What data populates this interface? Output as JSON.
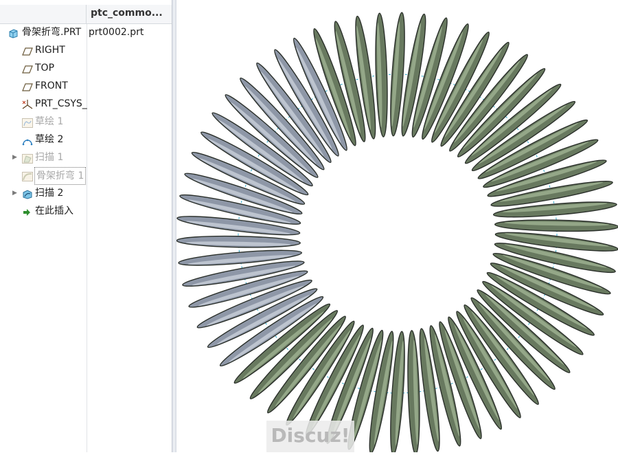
{
  "tree_header": {
    "column_title": "ptc_commo..."
  },
  "model_tree": [
    {
      "label": "骨架折弯.PRT",
      "icon": "part-icon",
      "col2": "prt0002.prt",
      "expandable": false,
      "state": "normal"
    },
    {
      "label": "RIGHT",
      "icon": "datum-plane-icon",
      "expandable": false,
      "state": "normal"
    },
    {
      "label": "TOP",
      "icon": "datum-plane-icon",
      "expandable": false,
      "state": "normal"
    },
    {
      "label": "FRONT",
      "icon": "datum-plane-icon",
      "expandable": false,
      "state": "normal"
    },
    {
      "label": "PRT_CSYS_",
      "icon": "csys-icon",
      "expandable": false,
      "state": "normal"
    },
    {
      "label": "草绘 1",
      "icon": "sketch-icon",
      "expandable": false,
      "state": "suppressed"
    },
    {
      "label": "草绘 2",
      "icon": "sketch-icon",
      "expandable": false,
      "state": "normal"
    },
    {
      "label": "扫描 1",
      "icon": "sweep-icon",
      "expandable": true,
      "state": "suppressed"
    },
    {
      "label": "骨架折弯 1",
      "icon": "spinal-bend-icon",
      "expandable": false,
      "state": "suppressed-selected"
    },
    {
      "label": "扫描 2",
      "icon": "sweep-icon",
      "expandable": true,
      "state": "normal"
    },
    {
      "label": "在此插入",
      "icon": "insert-here-arrow-icon",
      "expandable": false,
      "state": "normal"
    }
  ],
  "viewport": {
    "model": "toroidal-coil-spring",
    "coil_count": 62,
    "colors": {
      "coil_green": "#68795f",
      "coil_green_highlight": "#9fb392",
      "coil_gray": "#8e97a7",
      "coil_gray_highlight": "#c9cfda",
      "outline": "#2a2f2a",
      "datum_curve": "#2aa7c9"
    }
  },
  "watermark": {
    "text": "Discuz!"
  }
}
